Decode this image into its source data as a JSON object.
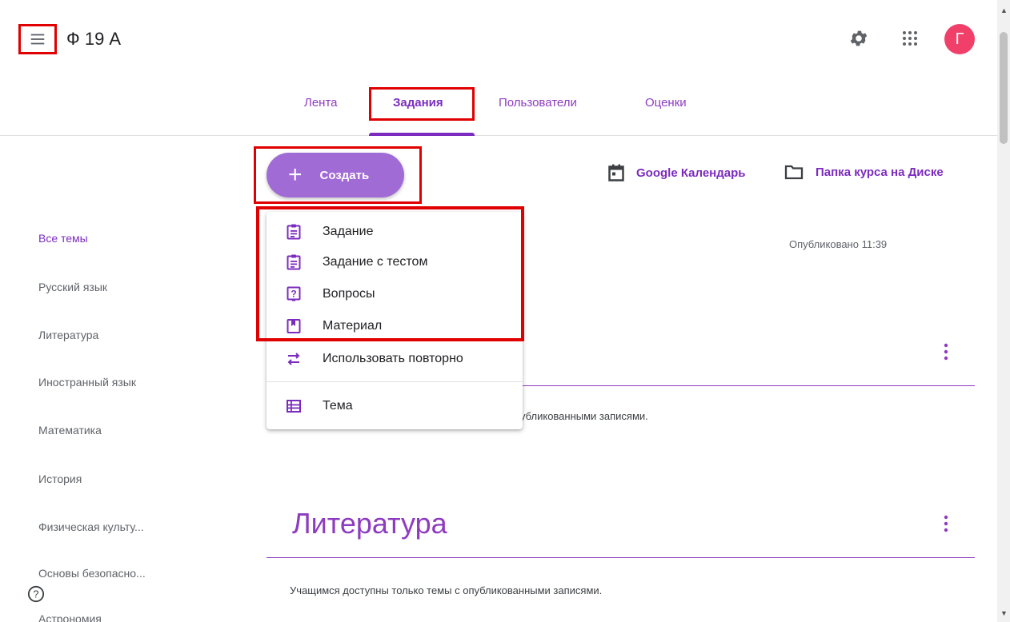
{
  "header": {
    "class_title": "Ф 19 А",
    "avatar_letter": "Г",
    "avatar_color": "#f0406a"
  },
  "tabs": [
    {
      "label": "Лента"
    },
    {
      "label": "Задания"
    },
    {
      "label": "Пользователи"
    },
    {
      "label": "Оценки"
    }
  ],
  "toolbar": {
    "create_label": "Создать",
    "calendar_label": "Google Календарь",
    "drive_folder_label": "Папка курса на Диске"
  },
  "create_menu": {
    "items": [
      {
        "label": "Задание",
        "icon": "assignment-icon"
      },
      {
        "label": "Задание с тестом",
        "icon": "quiz-assignment-icon"
      },
      {
        "label": "Вопросы",
        "icon": "question-icon"
      },
      {
        "label": "Материал",
        "icon": "material-icon"
      },
      {
        "label": "Использовать повторно",
        "icon": "reuse-icon"
      },
      {
        "label": "Тема",
        "icon": "topic-icon"
      }
    ]
  },
  "sidebar": {
    "topics": [
      {
        "label": "Все темы"
      },
      {
        "label": "Русский язык"
      },
      {
        "label": "Литература"
      },
      {
        "label": "Иностранный язык"
      },
      {
        "label": "Математика"
      },
      {
        "label": "История"
      },
      {
        "label": "Физическая культу..."
      },
      {
        "label": "Основы безопасно..."
      },
      {
        "label": "Астрономия"
      }
    ]
  },
  "main": {
    "published_text": "Опубликовано 11:39",
    "first_section_note": "убликованными записями.",
    "literature_title": "Литература",
    "literature_note": "Учащимся доступны только темы с опубликованными записями."
  },
  "colors": {
    "accent": "#7b2cbf",
    "create_button": "#a16bd6",
    "highlight": "#e00000"
  }
}
